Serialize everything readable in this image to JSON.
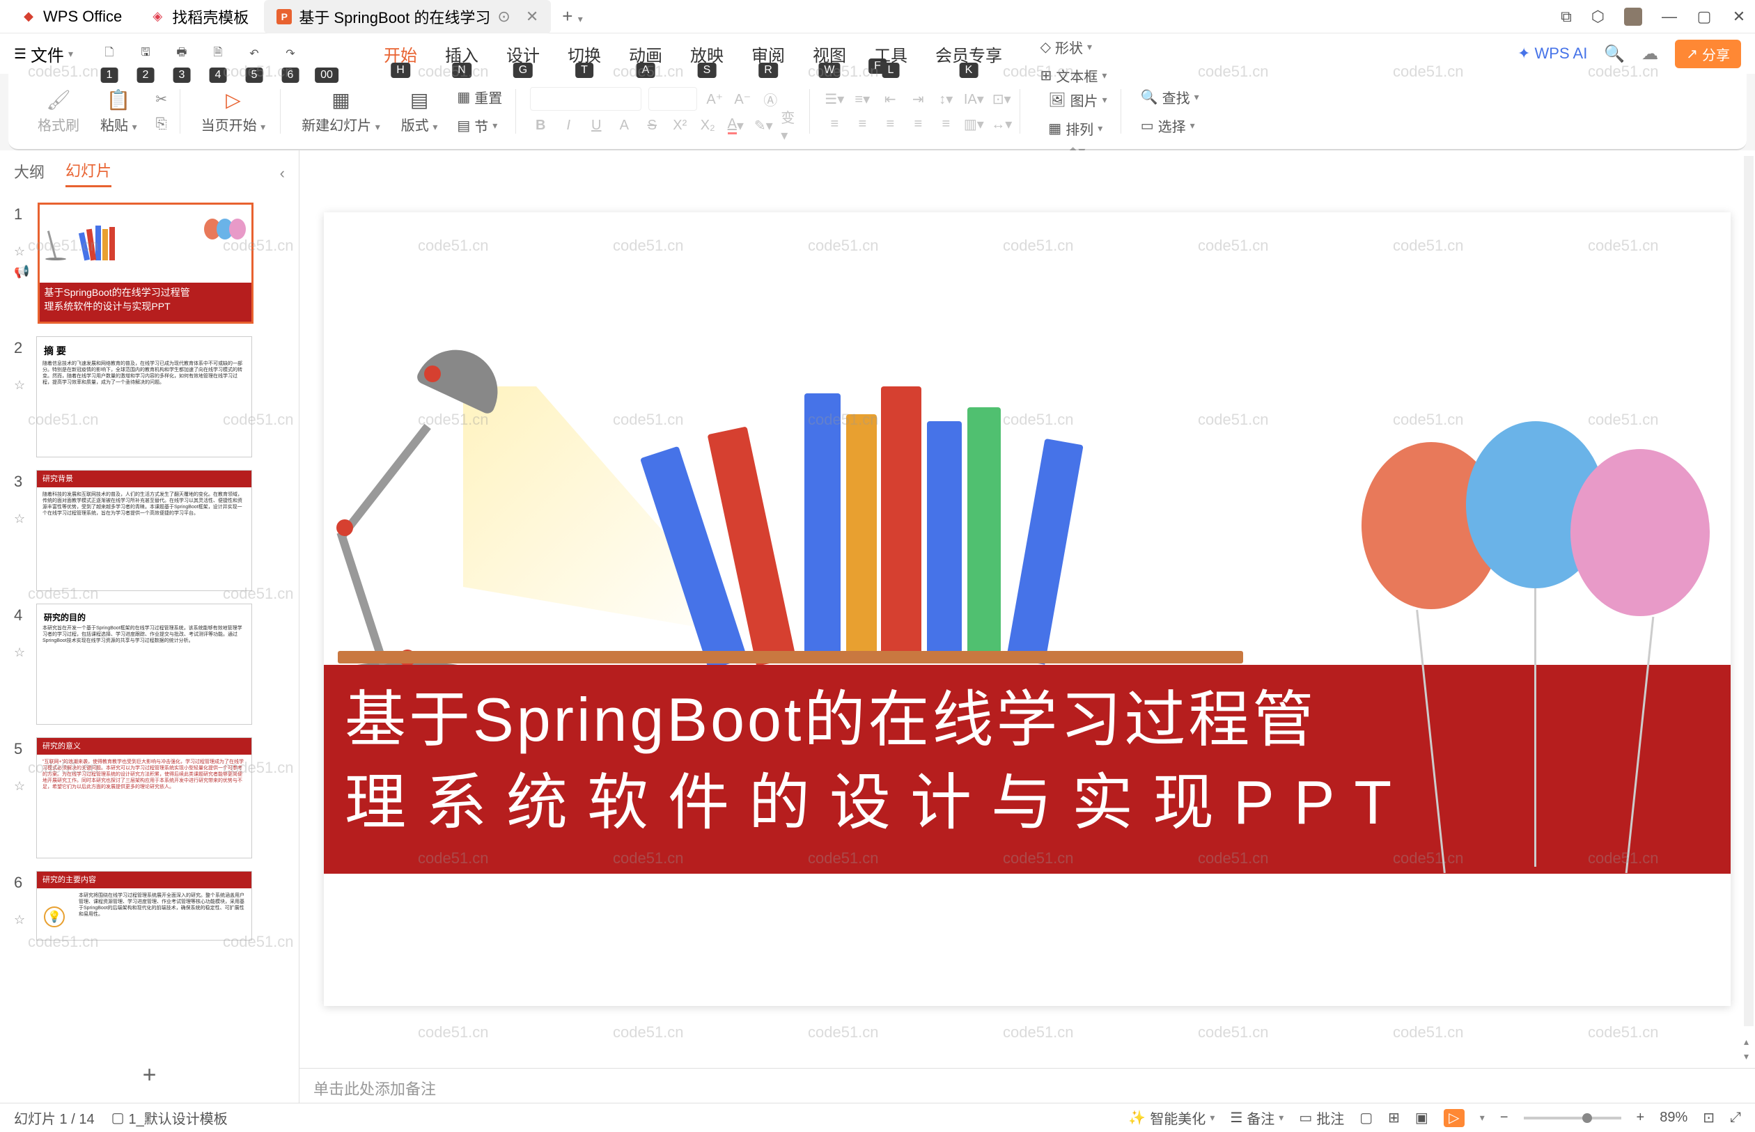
{
  "titlebar": {
    "app_name": "WPS Office",
    "tab2": "找稻壳模板",
    "tab3": "基于 SpringBoot 的在线学习",
    "add": "+"
  },
  "menu": {
    "file": "文件",
    "tabs": [
      "开始",
      "插入",
      "设计",
      "切换",
      "动画",
      "放映",
      "审阅",
      "视图",
      "工具",
      "会员专享"
    ],
    "hints_file": "F",
    "hints_qat": [
      "1",
      "2",
      "3",
      "4",
      "5",
      "6",
      "00"
    ],
    "hints_tabs": [
      "H",
      "N",
      "G",
      "T",
      "A",
      "S",
      "R",
      "W",
      "L",
      "K"
    ],
    "ai": "WPS AI",
    "share": "分享"
  },
  "ribbon": {
    "format_painter": "格式刷",
    "paste": "粘贴",
    "from_current": "当页开始",
    "new_slide": "新建幻灯片",
    "layout": "版式",
    "section": "节",
    "reset": "重置",
    "shape": "形状",
    "textbox": "文本框",
    "picture": "图片",
    "arrange": "排列",
    "find": "查找",
    "select": "选择"
  },
  "panel": {
    "outline": "大纲",
    "slides": "幻灯片"
  },
  "slides": {
    "s1_line1": "基于SpringBoot的在线学习过程管",
    "s1_line2": "理系统软件的设计与实现PPT",
    "s2_title": "摘 要",
    "s3_title": "研究背景",
    "s4_title": "研究的目的",
    "s5_title": "研究的意义",
    "s6_title": "研究的主要内容"
  },
  "canvas": {
    "title_line1": "基于SpringBoot的在线学习过程管",
    "title_line2": "理系统软件的设计与实现PPT"
  },
  "notes": {
    "placeholder": "单击此处添加备注"
  },
  "status": {
    "slide_count": "幻灯片 1 / 14",
    "template": "1_默认设计模板",
    "beautify": "智能美化",
    "notes": "备注",
    "comments": "批注",
    "zoom": "89%"
  },
  "watermark": "code51.cn"
}
